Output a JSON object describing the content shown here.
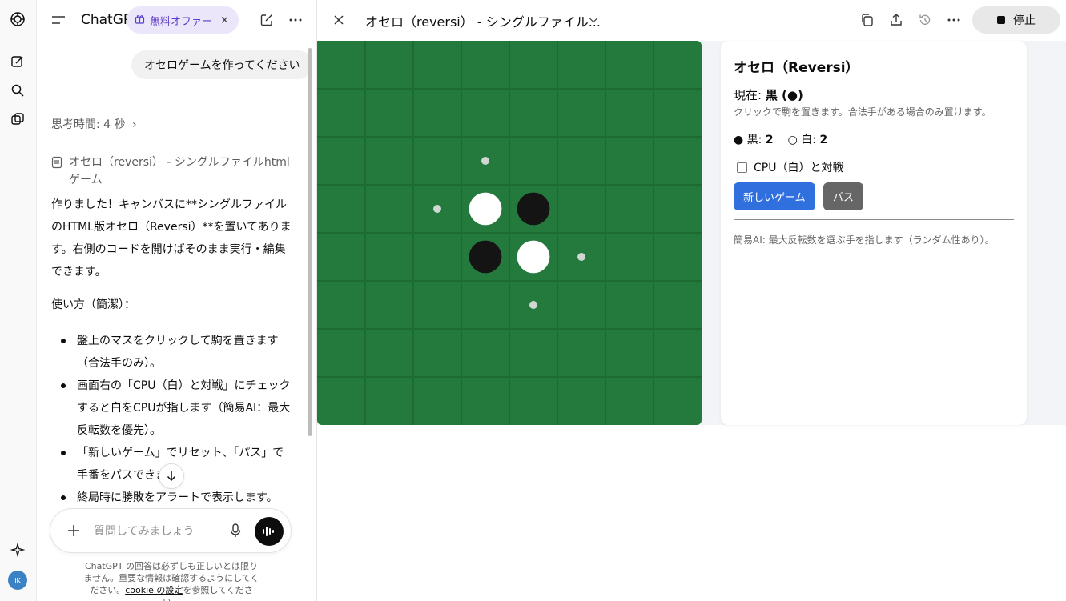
{
  "rail": {
    "icons": [
      "openai-logo-icon",
      "new-chat-icon",
      "search-icon",
      "library-icon",
      "sparkle-icon"
    ],
    "avatar_initials": "IK"
  },
  "chat": {
    "brand": "ChatGP",
    "offer_label": "無料オファー",
    "offer_close": "×",
    "user_message": "オセロゲームを作ってください",
    "thinking": "思考時間: 4 秒",
    "canvas_ref": "オセロ（reversi） - シングルファイルhtmlゲーム",
    "reply": "作りました！キャンバスに**シングルファイルのHTML版オセロ（Reversi）**を置いてあります。右側のコードを開けばそのまま実行・編集できます。",
    "howto_title": "使い方（簡潔）：",
    "howto_items": [
      "盤上のマスをクリックして駒を置きます（合法手のみ）。",
      "画面右の「CPU（白）と対戦」にチェックすると白をCPUが指します（簡易AI：最大反転数を優先）。",
      "「新しいゲーム」でリセット、「パス」で手番をパスできます。",
      "終局時に勝敗をアラートで表示します。"
    ],
    "composer_placeholder": "質問してみましょう",
    "disclaimer_pre": "ChatGPT の回答は必ずしも正しいとは限りません。重要な情報は確認するようにしてください。",
    "disclaimer_link": "cookie の設定",
    "disclaimer_post": "を参照してください。"
  },
  "panel": {
    "title": "オセロ（reversi） - シングルファイル...",
    "stop_label": "停止"
  },
  "game": {
    "title": "オセロ（Reversi）",
    "turn_label": "現在: ",
    "turn_value": "黒 (●)",
    "hint": "クリックで駒を置きます。合法手がある場合のみ置けます。",
    "black_label": "● 黒: ",
    "black_count": "2",
    "white_label": "○ 白: ",
    "white_count": "2",
    "cpu_label": "CPU（白）と対戦",
    "new_game": "新しいゲーム",
    "pass": "パス",
    "ai_note": "簡易AI: 最大反転数を選ぶ手を指します（ランダム性あり）。",
    "board": {
      "size": 8,
      "pieces": [
        {
          "row": 3,
          "col": 3,
          "color": "white"
        },
        {
          "row": 3,
          "col": 4,
          "color": "black"
        },
        {
          "row": 4,
          "col": 3,
          "color": "black"
        },
        {
          "row": 4,
          "col": 4,
          "color": "white"
        }
      ],
      "legal_moves": [
        {
          "row": 2,
          "col": 3
        },
        {
          "row": 3,
          "col": 2
        },
        {
          "row": 4,
          "col": 5
        },
        {
          "row": 5,
          "col": 4
        }
      ],
      "colors": {
        "board": "#237a3c",
        "grid": "#1e6a33",
        "black": "#141414",
        "white": "#ffffff",
        "hint": "#cfd8d2"
      }
    }
  },
  "colors": {
    "primary_button": "#2f6fde",
    "pass_button": "#666666",
    "offer_bg": "#ece6fb",
    "offer_text": "#5b3dc8"
  }
}
